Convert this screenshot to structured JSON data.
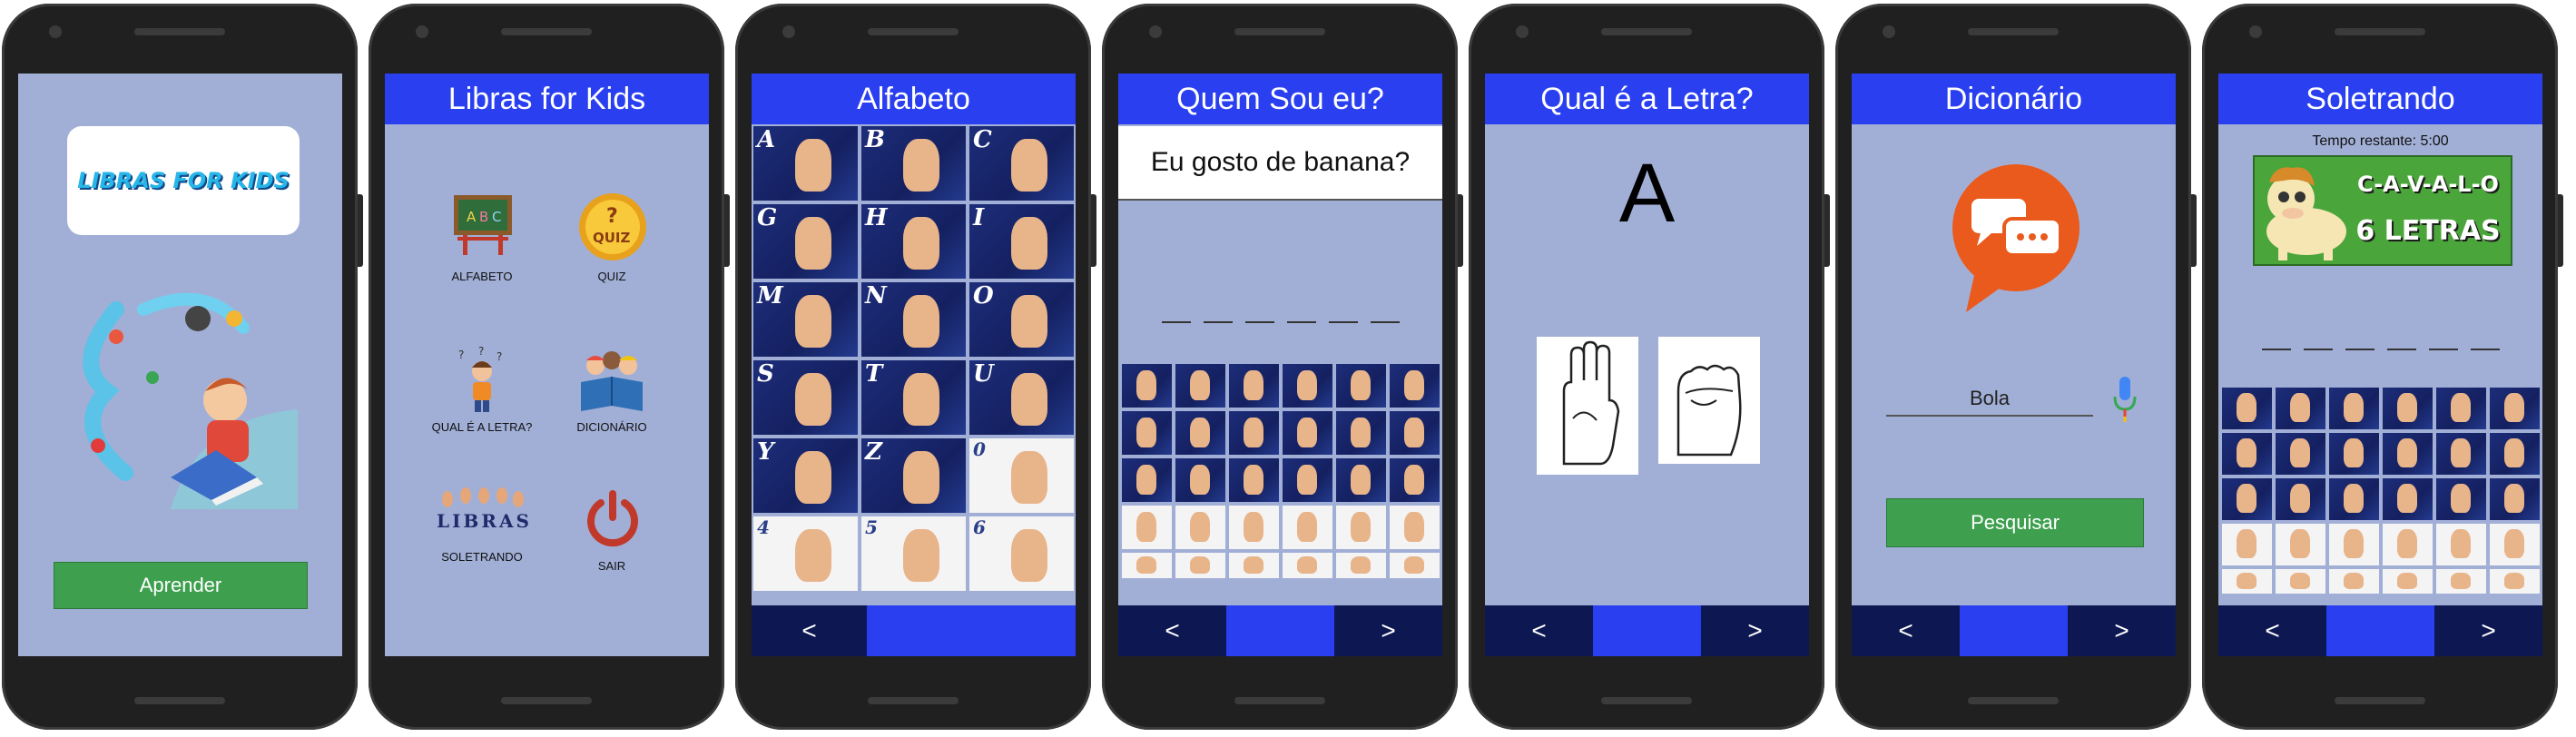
{
  "screens": {
    "splash": {
      "logo_text": "LIBRAS FOR KIDS",
      "learn_button": "Aprender"
    },
    "menu": {
      "title": "Libras for Kids",
      "items": [
        {
          "label": "ALFABETO",
          "icon": "chalkboard-icon"
        },
        {
          "label": "QUIZ",
          "icon": "quiz-badge-icon"
        },
        {
          "label": "QUAL É A LETRA?",
          "icon": "thinking-boy-icon"
        },
        {
          "label": "DICIONÁRIO",
          "icon": "kids-reading-icon"
        },
        {
          "label": "SOLETRANDO",
          "icon": "libras-hands-icon"
        },
        {
          "label": "SAIR",
          "icon": "power-icon"
        }
      ],
      "libras_art_text": "LIBRAS"
    },
    "alphabet": {
      "title": "Alfabeto",
      "letters": [
        "A",
        "B",
        "C",
        "G",
        "H",
        "I",
        "M",
        "N",
        "O",
        "S",
        "T",
        "U",
        "Y",
        "Z",
        "0",
        "4",
        "5",
        "6"
      ],
      "nav_prev": "<"
    },
    "quiz": {
      "title": "Quem Sou eu?",
      "question": "Eu gosto de banana?",
      "blank_count": 6,
      "nav_prev": "<",
      "nav_next": ">"
    },
    "which_letter": {
      "title": "Qual é a Letra?",
      "letter": "A",
      "nav_prev": "<",
      "nav_next": ">"
    },
    "dictionary": {
      "title": "Dicionário",
      "search_value": "Bola",
      "search_button": "Pesquisar",
      "nav_prev": "<",
      "nav_next": ">"
    },
    "spelling": {
      "title": "Soletrando",
      "timer": "Tempo restante: 5:00",
      "banner_word": "C-A-V-A-L-O",
      "banner_count": "6 LETRAS",
      "blank_count": 6,
      "nav_prev": "<",
      "nav_next": ">"
    }
  },
  "colors": {
    "appbar": "#2a3ff0",
    "screen_bg": "#a1afd6",
    "navbar": "#0d1852",
    "button_green": "#3ea04e"
  }
}
